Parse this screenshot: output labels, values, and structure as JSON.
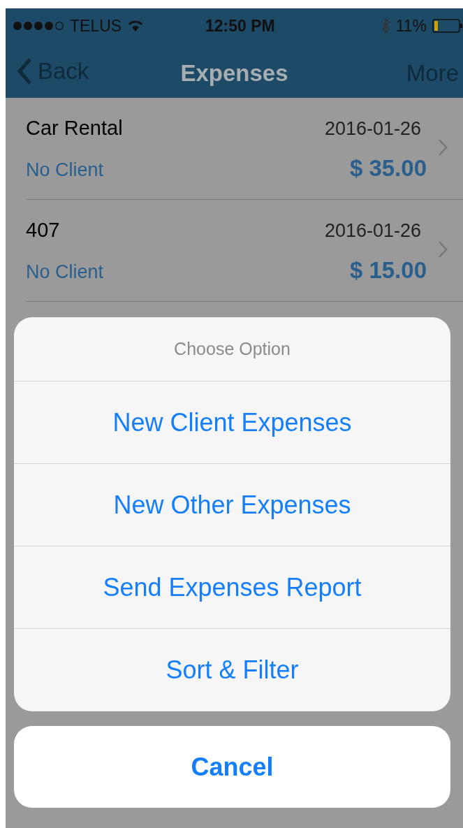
{
  "status_bar": {
    "carrier": "TELUS",
    "time": "12:50 PM",
    "battery": "11%"
  },
  "nav": {
    "back": "Back",
    "title": "Expenses",
    "right": "More"
  },
  "expenses": [
    {
      "name": "Car Rental",
      "date": "2016-01-26",
      "client": "No Client",
      "amount": "$ 35.00"
    },
    {
      "name": "407",
      "date": "2016-01-26",
      "client": "No Client",
      "amount": "$ 15.00"
    }
  ],
  "action_sheet": {
    "title": "Choose Option",
    "options": [
      "New Client Expenses",
      "New Other Expenses",
      "Send Expenses Report",
      "Sort & Filter"
    ],
    "cancel": "Cancel"
  }
}
